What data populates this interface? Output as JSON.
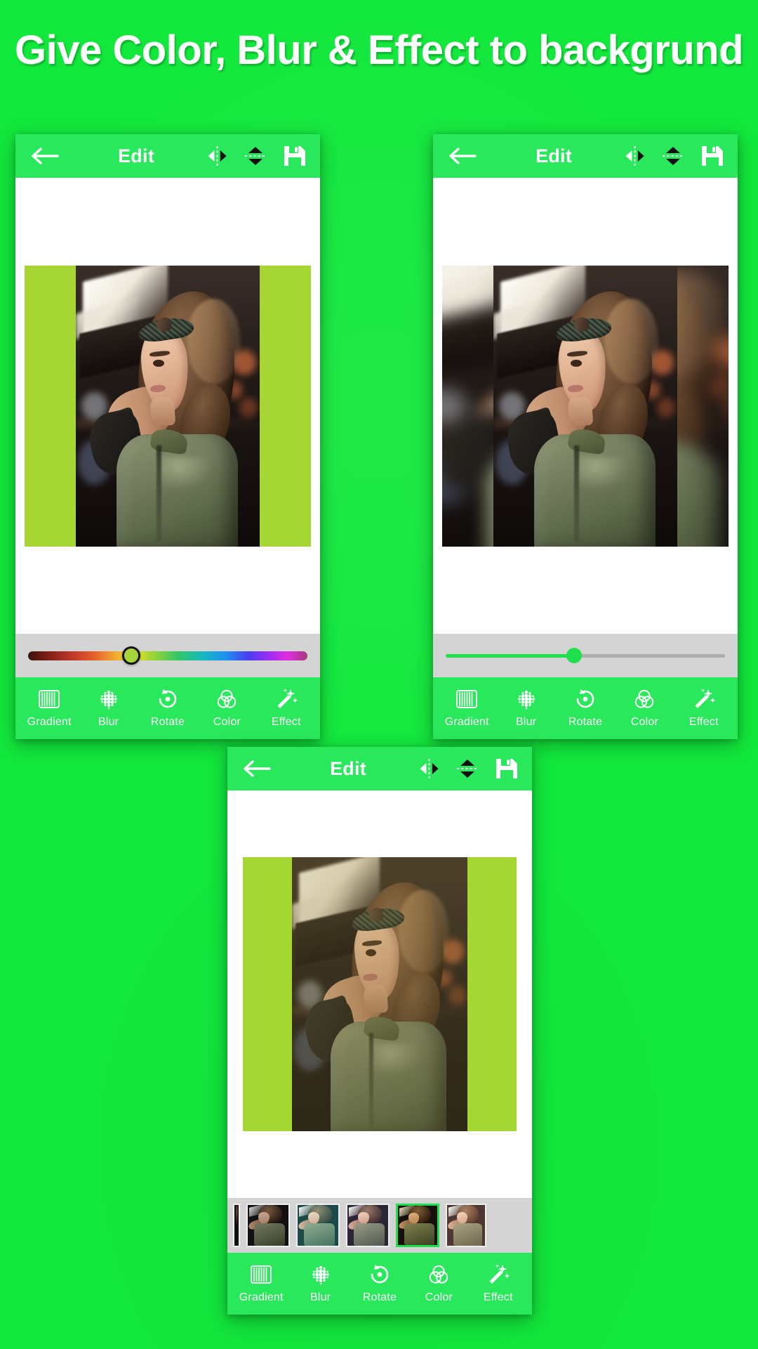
{
  "theme": {
    "background_green": "#12E83C",
    "appbar_green": "#2AE85C",
    "artboard_green": "#A5D634",
    "slider_panel_gray": "#D4D4D4",
    "accent_white": "#FFFFFF"
  },
  "headline": {
    "text": "Give Color, Blur & Effect to backgrund"
  },
  "appbar": {
    "back_icon": "back-arrow-icon",
    "title": "Edit",
    "flip_horizontal_icon": "flip-horizontal-icon",
    "flip_vertical_icon": "flip-vertical-icon",
    "save_icon": "save-floppy-icon"
  },
  "toolbar": {
    "items": [
      {
        "label": "Gradient",
        "icon": "gradient-stripes-icon"
      },
      {
        "label": "Blur",
        "icon": "blur-dots-icon"
      },
      {
        "label": "Rotate",
        "icon": "rotate-ccw-icon"
      },
      {
        "label": "Color",
        "icon": "color-circles-icon"
      },
      {
        "label": "Effect",
        "icon": "magic-wand-icon"
      }
    ]
  },
  "screens": [
    {
      "id": "screen-gradient-color",
      "active_tool": "Gradient",
      "control": {
        "type": "hue-slider",
        "thumb_position_percent": 37,
        "thumb_color": "#A6D63B",
        "background_color": "#A5D634"
      }
    },
    {
      "id": "screen-blur",
      "active_tool": "Blur",
      "control": {
        "type": "value-slider",
        "fill_percent": 46,
        "fill_color": "#1FE04C",
        "track_color": "#ADADAD"
      }
    },
    {
      "id": "screen-effect",
      "active_tool": "Effect",
      "control": {
        "type": "filter-thumbnails",
        "selected_index": 3,
        "thumbnails": [
          {
            "name": "filter-original",
            "tint": "t-dark"
          },
          {
            "name": "filter-dark",
            "tint": "t-dark"
          },
          {
            "name": "filter-teal",
            "tint": "t-teal"
          },
          {
            "name": "filter-cool",
            "tint": "t-cool"
          },
          {
            "name": "filter-warm",
            "tint": "t-warm"
          },
          {
            "name": "filter-sepia",
            "tint": "t-sepia"
          }
        ]
      }
    }
  ],
  "photo": {
    "subject": "woman-portrait-with-bandana-and-olive-jacket"
  }
}
